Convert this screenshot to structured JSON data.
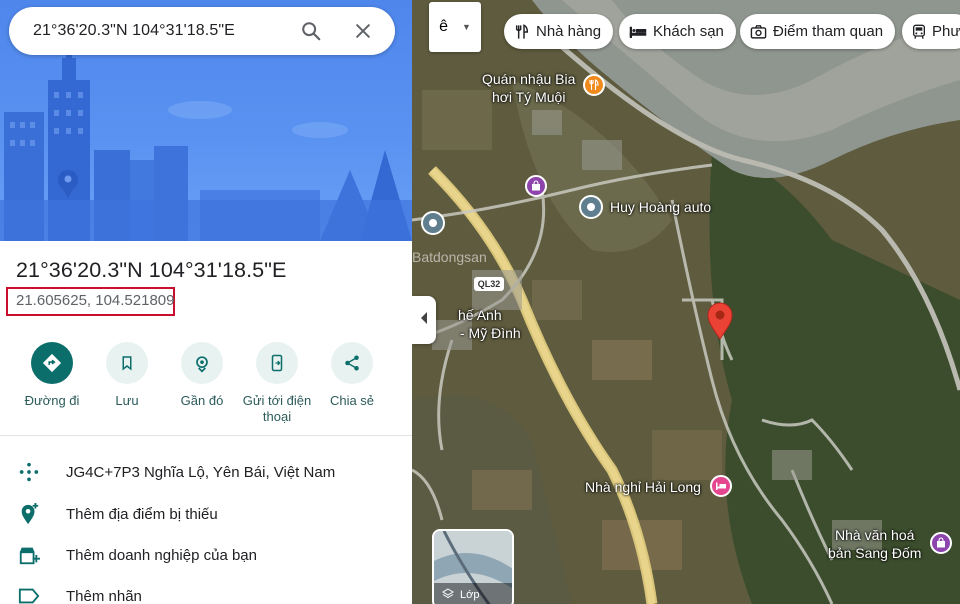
{
  "search": {
    "query": "21°36'20.3\"N 104°31'18.5\"E"
  },
  "place": {
    "title": "21°36'20.3\"N 104°31'18.5\"E",
    "decimal": "21.605625, 104.521809"
  },
  "actions": [
    {
      "label": "Đường đi",
      "icon": "directions-icon"
    },
    {
      "label": "Lưu",
      "icon": "bookmark-icon"
    },
    {
      "label": "Gần đó",
      "icon": "nearby-icon"
    },
    {
      "label": "Gửi tới điện thoại",
      "icon": "send-to-phone-icon"
    },
    {
      "label": "Chia sẻ",
      "icon": "share-icon"
    }
  ],
  "details": [
    {
      "text": "JG4C+7P3 Nghĩa Lộ, Yên Bái, Việt Nam",
      "icon": "plus-code-icon"
    },
    {
      "text": "Thêm địa điểm bị thiếu",
      "icon": "add-place-icon"
    },
    {
      "text": "Thêm doanh nghiệp của bạn",
      "icon": "add-business-icon"
    },
    {
      "text": "Thêm nhãn",
      "icon": "label-icon"
    }
  ],
  "map": {
    "layer_switch": "ê",
    "chips": [
      {
        "label": "Nhà hàng",
        "icon": "restaurant-icon"
      },
      {
        "label": "Khách sạn",
        "icon": "hotel-icon"
      },
      {
        "label": "Điểm tham quan",
        "icon": "camera-icon"
      },
      {
        "label": "Phư",
        "icon": "transit-icon"
      }
    ],
    "labels": {
      "quan_nhau_line1": "Quán nhậu Bia",
      "quan_nhau_line2": "hơi Tý Muội",
      "huy_hoang": "Huy Hoàng auto",
      "the_anh_line1": "hế Anh",
      "the_anh_line2": "- Mỹ Đình",
      "nha_nghi": "Nhà nghỉ Hải Long",
      "nha_van_hoa_line1": "Nhà văn hoá",
      "nha_van_hoa_line2": "bản Sang Đốm",
      "road": "QL32",
      "watermark": "Batdongsan"
    },
    "layers_label": "Lớp",
    "colors": {
      "pin": "#ea4335",
      "hotel": "#e4468f",
      "food": "#f08a1d",
      "shopping": "#8e44ad",
      "road": "#e8d48a"
    }
  }
}
